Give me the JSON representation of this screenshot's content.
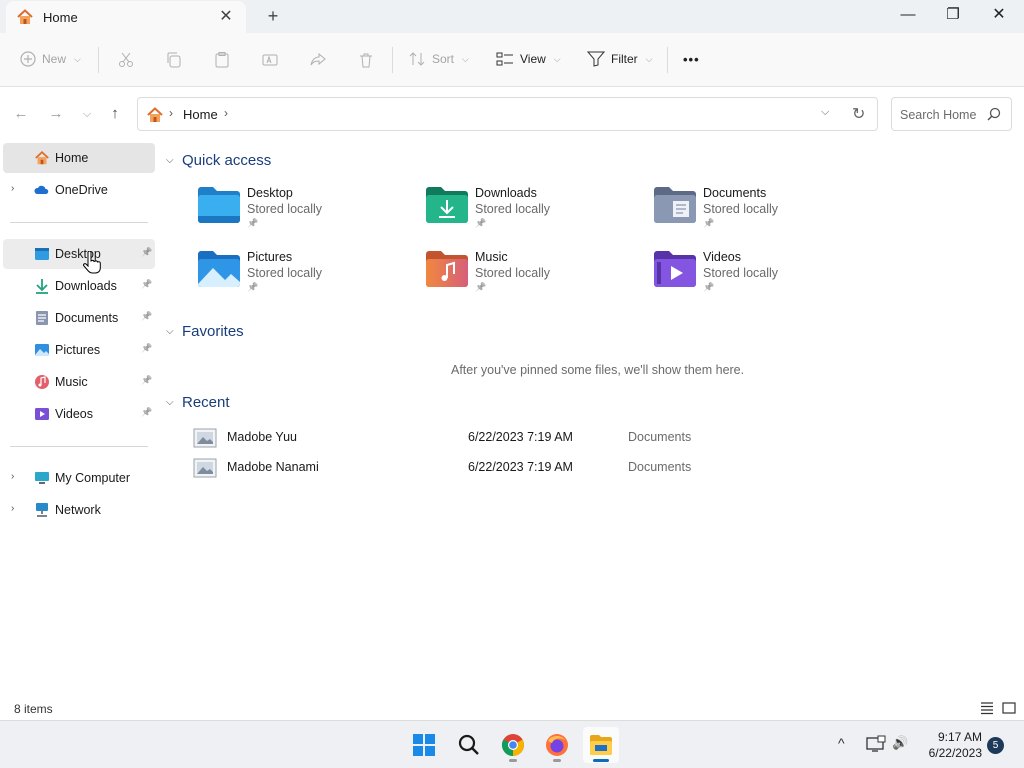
{
  "window": {
    "tab_title": "Home",
    "tab_close": "✕",
    "new_tab": "+",
    "minimize": "—",
    "maximize": "❐",
    "close": "✕"
  },
  "commandbar": {
    "new_label": "New",
    "sort_label": "Sort",
    "view_label": "View",
    "filter_label": "Filter",
    "more_label": "•••",
    "caret": "⌵"
  },
  "navigation": {
    "back": "←",
    "forward": "→",
    "recent": "⌵",
    "up": "↑"
  },
  "address": {
    "crumb": "Home",
    "separator": "›",
    "dropdown": "⌵",
    "refresh": "↻"
  },
  "search": {
    "placeholder": "Search Home"
  },
  "sidebar": {
    "home": "Home",
    "onedrive": "OneDrive",
    "pinned": [
      {
        "label": "Desktop",
        "icon": "desktop-icon"
      },
      {
        "label": "Downloads",
        "icon": "downloads-icon"
      },
      {
        "label": "Documents",
        "icon": "documents-icon"
      },
      {
        "label": "Pictures",
        "icon": "pictures-icon"
      },
      {
        "label": "Music",
        "icon": "music-icon"
      },
      {
        "label": "Videos",
        "icon": "videos-icon"
      }
    ],
    "my_computer": "My Computer",
    "network": "Network",
    "chevron": "›",
    "pin_glyph": "📌"
  },
  "main": {
    "quick_access": {
      "title": "Quick access",
      "items": [
        {
          "name": "Desktop",
          "sub": "Stored locally",
          "color": "#2f9be0"
        },
        {
          "name": "Downloads",
          "sub": "Stored locally",
          "color": "#21a37e"
        },
        {
          "name": "Documents",
          "sub": "Stored locally",
          "color": "#7b8aa6"
        },
        {
          "name": "Pictures",
          "sub": "Stored locally",
          "color": "#2f8fe0"
        },
        {
          "name": "Music",
          "sub": "Stored locally",
          "color": "#e8764f"
        },
        {
          "name": "Videos",
          "sub": "Stored locally",
          "color": "#7a4fd6"
        }
      ]
    },
    "favorites": {
      "title": "Favorites",
      "empty_text": "After you've pinned some files, we'll show them here."
    },
    "recent": {
      "title": "Recent",
      "items": [
        {
          "name": "Madobe Yuu",
          "date": "6/22/2023 7:19 AM",
          "location": "Documents"
        },
        {
          "name": "Madobe Nanami",
          "date": "6/22/2023 7:19 AM",
          "location": "Documents"
        }
      ]
    },
    "section_chevron": "⌵"
  },
  "status": {
    "item_count": "8 items"
  },
  "taskbar": {
    "time": "9:17 AM",
    "date": "6/22/2023",
    "notifications": "5",
    "tray_chevron": "^",
    "volume": "🔊"
  },
  "colors": {
    "accent": "#0a6cbc",
    "section_title": "#1a3d7c"
  }
}
